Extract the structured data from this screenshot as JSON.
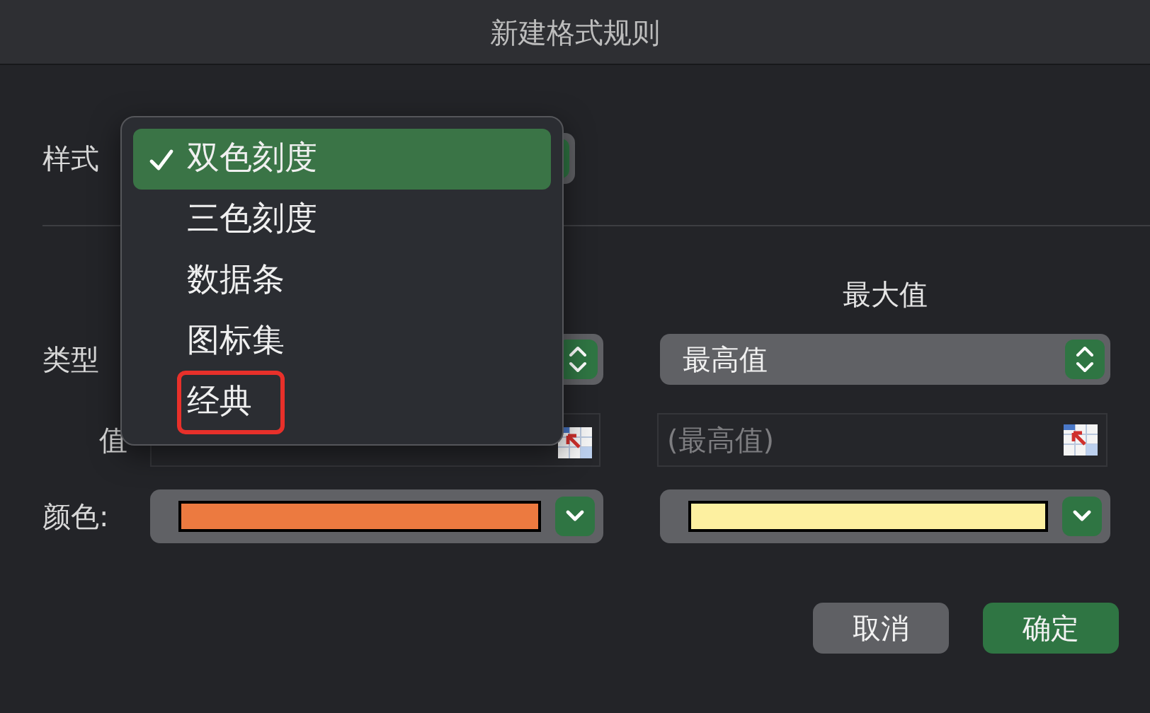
{
  "window": {
    "title": "新建格式规则"
  },
  "style_row": {
    "label": "样式"
  },
  "style_menu": {
    "items": [
      {
        "label": "双色刻度",
        "selected": true,
        "outlined": false
      },
      {
        "label": "三色刻度",
        "selected": false,
        "outlined": false
      },
      {
        "label": "数据条",
        "selected": false,
        "outlined": false
      },
      {
        "label": "图标集",
        "selected": false,
        "outlined": false
      },
      {
        "label": "经典",
        "selected": false,
        "outlined": true
      }
    ]
  },
  "columns": {
    "max_header": "最大值"
  },
  "type_row": {
    "label": "类型",
    "max_value": "最高值"
  },
  "value_row": {
    "label": "值",
    "max_placeholder": "(最高值)"
  },
  "color_row": {
    "label": "颜色:",
    "wells": [
      {
        "color": "#ec7a40"
      },
      {
        "color": "#fdf0a0"
      }
    ]
  },
  "buttons": [
    {
      "label": "取消",
      "kind": "cancel"
    },
    {
      "label": "确定",
      "kind": "default"
    }
  ]
}
